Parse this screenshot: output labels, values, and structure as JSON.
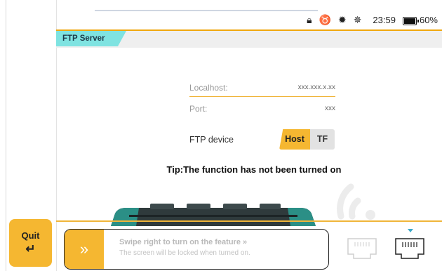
{
  "status_bar": {
    "icons": [
      "lock-icon",
      "usb-plug-icon",
      "gear-sun-icon",
      "brightness-icon"
    ],
    "time": "23:59",
    "battery": "60%"
  },
  "header": {
    "title": "FTP Server"
  },
  "form": {
    "localhost_label": "Localhost:",
    "localhost_value": "xxx.xxx.x.xx",
    "port_label": "Port:",
    "port_value": "xxx",
    "device_label": "FTP device",
    "device_options": [
      "Host",
      "TF"
    ],
    "device_selected": "Host"
  },
  "tip": "Tip:The function has not been turned on",
  "quit": {
    "label": "Quit",
    "icon": "return-arrow-icon"
  },
  "swipe": {
    "icon": "double-chevron-right-icon",
    "title": "Swipe right to turn on the feature",
    "title_chevron": "»",
    "subtitle": "The screen will be locked when turned on."
  },
  "ports": [
    "ethernet-port-1-icon",
    "ethernet-port-2-icon"
  ],
  "colors": {
    "accent": "#f5b731",
    "tab": "#7fe3e1",
    "divider": "#f0b53a"
  }
}
